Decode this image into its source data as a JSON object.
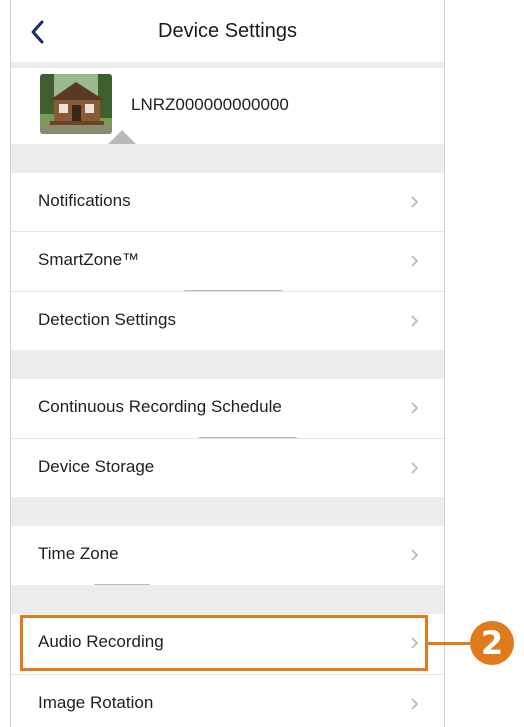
{
  "header": {
    "title": "Device Settings"
  },
  "device": {
    "name": "LNRZ000000000000"
  },
  "menu": {
    "notifications": "Notifications",
    "smartzone": "SmartZone™",
    "detection": "Detection Settings",
    "continuous": "Continuous Recording Schedule",
    "storage": "Device Storage",
    "timezone": "Time Zone",
    "audio": "Audio Recording",
    "rotation": "Image Rotation"
  },
  "callout": {
    "number": "2"
  },
  "colors": {
    "accent": "#e07b1b",
    "section_gap": "#ececec"
  },
  "icons": [
    "back-arrow-icon",
    "chevron-right-icon"
  ]
}
